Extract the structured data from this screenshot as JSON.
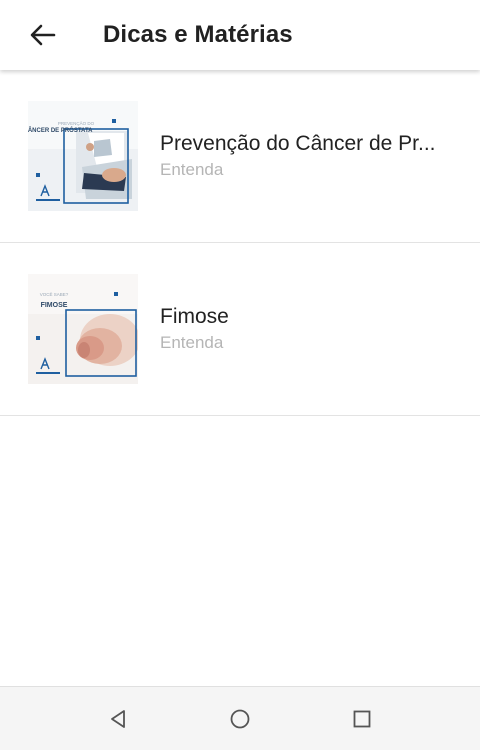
{
  "app_bar": {
    "back_icon": "arrow-left-icon",
    "title": "Dicas e Matérias"
  },
  "items": [
    {
      "thumb_caption": "PREVENÇÃO DO",
      "thumb_heading": "CÂNCER DE PRÓSTATA",
      "title": "Prevenção do Câncer de Pr...",
      "subtitle": "Entenda"
    },
    {
      "thumb_caption": "VOCÊ SABE?",
      "thumb_heading": "FIMOSE",
      "title": "Fimose",
      "subtitle": "Entenda"
    }
  ],
  "nav_bar": {
    "back_icon": "triangle-back-icon",
    "home_icon": "circle-home-icon",
    "recents_icon": "square-recents-icon"
  },
  "colors": {
    "accent": "#1f5fa0",
    "subtitle": "#b5b5b5",
    "divider": "#e3e3e3"
  }
}
